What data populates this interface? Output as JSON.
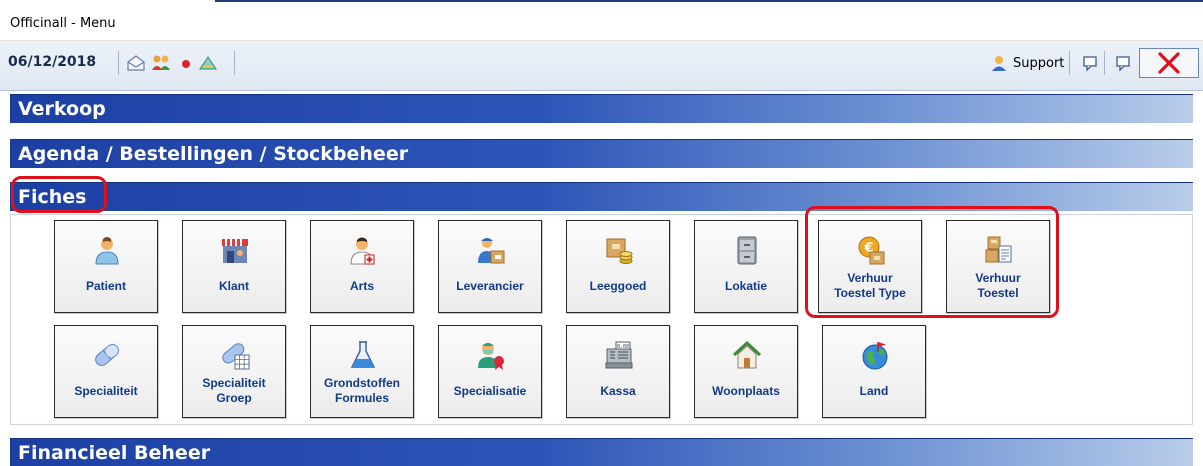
{
  "window": {
    "title": "Officinall - Menu"
  },
  "toolbar": {
    "date": "06/12/2018",
    "support_label": "Support",
    "icons": [
      "mail-icon",
      "users-icon",
      "red-dot-icon",
      "warning-icon"
    ]
  },
  "sections": {
    "verkoop": "Verkoop",
    "agenda": "Agenda / Bestellingen / Stockbeheer",
    "fiches": "Fiches",
    "financieel": "Financieel Beheer"
  },
  "fiches": {
    "row1": [
      {
        "line1": "Patient",
        "line2": "",
        "icon": "patient-icon"
      },
      {
        "line1": "Klant",
        "line2": "",
        "icon": "shop-icon"
      },
      {
        "line1": "Arts",
        "line2": "",
        "icon": "doctor-icon"
      },
      {
        "line1": "Leverancier",
        "line2": "",
        "icon": "supplier-icon"
      },
      {
        "line1": "Leeggoed",
        "line2": "",
        "icon": "boxes-coins-icon"
      },
      {
        "line1": "Lokatie",
        "line2": "",
        "icon": "cabinet-icon"
      },
      {
        "line1": "Verhuur",
        "line2": "Toestel Type",
        "icon": "euro-box-icon"
      },
      {
        "line1": "Verhuur",
        "line2": "Toestel",
        "icon": "box-document-icon"
      }
    ],
    "row2": [
      {
        "line1": "Specialiteit",
        "line2": "",
        "icon": "pill-icon"
      },
      {
        "line1": "Specialiteit",
        "line2": "Groep",
        "icon": "pill-grid-icon"
      },
      {
        "line1": "Grondstoffen",
        "line2": "Formules",
        "icon": "flask-icon"
      },
      {
        "line1": "Specialisatie",
        "line2": "",
        "icon": "surgeon-icon"
      },
      {
        "line1": "Kassa",
        "line2": "",
        "icon": "cash-register-icon"
      },
      {
        "line1": "Woonplaats",
        "line2": "",
        "icon": "house-icon"
      },
      {
        "line1": "Land",
        "line2": "",
        "icon": "globe-icon"
      }
    ]
  },
  "colors": {
    "section_bar_start": "#1c3fa3",
    "section_bar_end": "#b9cdea",
    "tile_label": "#133a8a",
    "highlight": "#e0101a",
    "close_x": "#e0101a"
  }
}
